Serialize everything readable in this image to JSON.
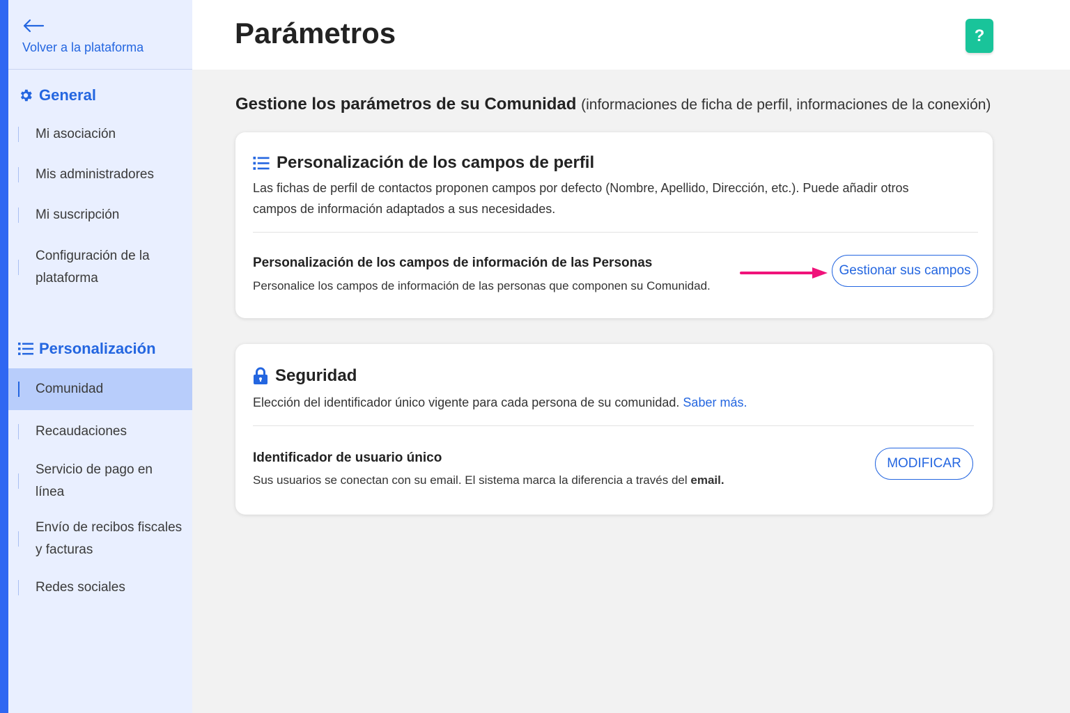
{
  "sidebar": {
    "back_label": "Volver a la plataforma",
    "sections": [
      {
        "title": "General",
        "icon": "gear-icon",
        "items": [
          "Mi asociación",
          "Mis administradores",
          "Mi suscripción",
          "Configuración de la plataforma"
        ]
      },
      {
        "title": "Personalización",
        "icon": "list-icon",
        "items": [
          "Comunidad",
          "Recaudaciones",
          "Servicio de pago en línea",
          "Envío de recibos fiscales y facturas",
          "Redes sociales"
        ]
      }
    ],
    "active_item": "Comunidad"
  },
  "header": {
    "title": "Parámetros",
    "help_label": "?"
  },
  "main": {
    "intro_bold": "Gestione los parámetros de su Comunidad",
    "intro_rest": "(informaciones de ficha de perfil, informaciones de la conexión)",
    "profile_card": {
      "title": "Personalización de los campos de perfil",
      "description": "Las fichas de perfil de contactos proponen campos por defecto (Nombre, Apellido, Dirección, etc.). Puede añadir otros campos de información adaptados a sus necesidades.",
      "row_title": "Personalización de los campos de información de las Personas",
      "row_desc": "Personalice los campos de información de las personas que componen su Comunidad.",
      "button_label": "Gestionar sus campos"
    },
    "security_card": {
      "title": "Seguridad",
      "description": "Elección del identificador único vigente para cada persona de su comunidad.",
      "link_label": "Saber más.",
      "row_title": "Identificador de usuario único",
      "row_desc": "Sus usuarios se conectan con su email. El sistema marca la diferencia a través del",
      "row_desc_bold": "email.",
      "button_label": "MODIFICAR"
    }
  },
  "colors": {
    "accent": "#2466e0",
    "sidebar_bg": "#e9efff",
    "sidebar_active": "#b8cdfb",
    "help_button": "#19c49a",
    "arrow": "#f0127a"
  }
}
